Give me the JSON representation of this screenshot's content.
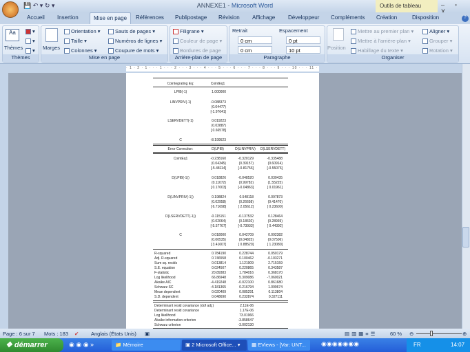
{
  "window": {
    "title_doc": "ANNEXE1",
    "title_sep": " - ",
    "title_app": "Microsoft Word",
    "context_tab": "Outils de tableau",
    "controls": "– ▫ X"
  },
  "tabs": [
    "Accueil",
    "Insertion",
    "Mise en page",
    "Références",
    "Publipostage",
    "Révision",
    "Affichage",
    "Développeur",
    "Compléments",
    "Création",
    "Disposition"
  ],
  "ribbon": {
    "themes": {
      "label": "Thèmes",
      "button": "Thèmes"
    },
    "mise_en_page": {
      "label": "Mise en page",
      "marges": "Marges",
      "orientation": "Orientation ▾",
      "taille": "Taille ▾",
      "colonnes": "Colonnes ▾",
      "sauts": "Sauts de pages ▾",
      "numeros": "Numéros de lignes ▾",
      "coupure": "Coupure de mots ▾"
    },
    "arriere_plan": {
      "label": "Arrière-plan de page",
      "filigrane": "Filigrane ▾",
      "couleur": "Couleur de page ▾",
      "bordures": "Bordures de page"
    },
    "paragraphe": {
      "label": "Paragraphe",
      "retrait": "Retrait",
      "espacement": "Espacement",
      "retrait_gauche": "0 cm",
      "retrait_droit": "0 cm",
      "avant": "0 pt",
      "apres": "10 pt"
    },
    "organiser": {
      "label": "Organiser",
      "position": "Position",
      "premier_plan": "Mettre au premier plan ▾",
      "arriere_plan": "Mettre à l'arrière-plan ▾",
      "habillage": "Habillage du texte ▾",
      "aligner": "Aligner ▾",
      "grouper": "Grouper ▾",
      "rotation": "Rotation ▾"
    }
  },
  "ruler": "· 1 · 2 · 1 · · · 1 · · · 2 · · · 3 · · · 4 · · · 5 · · · 6 · · · 7 · · · 8 · · · 9 · · · 10 · · · 11 · · · 12 · · · 13 · · · 14 · · · 15 · · · 16 · · · 17 · · · 18",
  "table": {
    "coint_header": [
      "Cointegrating Eq:",
      "CointEq1"
    ],
    "coint_rows": [
      {
        "label": "LPIB(-1)",
        "vals": [
          "1.000000"
        ]
      },
      {
        "label": "LINVPRIV(-1)",
        "vals": [
          "-0.088373",
          "(0.04477)",
          "[-1.97641]"
        ]
      },
      {
        "label": "LSERVDETT(-1)",
        "vals": [
          "0.019223",
          "(0.02887)",
          "[ 0.66578]"
        ]
      },
      {
        "label": "C",
        "vals": [
          "-8.199523"
        ]
      }
    ],
    "ec_header": [
      "Error Correction:",
      "D(LPIB)",
      "D(LINVPRIV)",
      "D(LSERVDETT)"
    ],
    "ec_rows": [
      {
        "label": "CointEq1",
        "cols": [
          [
            "-0.238160",
            "(0.04345)",
            "[-5.48114]"
          ],
          [
            "-0.320129",
            "(0.39157)",
            "[-0.81756]"
          ],
          [
            "-0.335488",
            "(0.60914)",
            "[-0.55076]"
          ]
        ]
      },
      {
        "label": "D(LPIB(-1))",
        "cols": [
          [
            "0.018826",
            "(0.11072)",
            "[ 0.17003]"
          ],
          [
            "-0.048520",
            "(0.99782)",
            "[-0.04863]"
          ],
          [
            "0.030435",
            "(1.55225)",
            "[ 0.01961]"
          ]
        ]
      },
      {
        "label": "D(LINVPRIV(-1))",
        "cols": [
          [
            "0.198824",
            "(0.02958)",
            "[ 6.71698]"
          ],
          [
            "0.548118",
            "(0.26658)",
            "[ 2.05612]"
          ],
          [
            "0.097873",
            "(0.41470)",
            "[ 0.23600]"
          ]
        ]
      },
      {
        "label": "D(LSERVDETT(-1))",
        "cols": [
          [
            "-0.115151",
            "(0.02064)",
            "[-5.57767]"
          ],
          [
            "-0.137532",
            "(0.18602)",
            "[-0.73933]"
          ],
          [
            "0.128464",
            "(0.28939)",
            "[ 0.44392]"
          ]
        ]
      },
      {
        "label": "C",
        "cols": [
          [
            "0.018000",
            "(0.00535)",
            "[ 3.41607]"
          ],
          [
            "0.042709",
            "(0.04825)",
            "[ 0.88520]"
          ],
          [
            "0.092382",
            "(0.07506)",
            "[ 1.23080]"
          ]
        ]
      }
    ],
    "stats": [
      {
        "label": "R-squared",
        "vals": [
          "0.784190",
          "0.228744",
          "0.050179"
        ]
      },
      {
        "label": "Adj. R-squared",
        "vals": [
          "0.746558",
          "0.100462",
          "-0.103271"
        ]
      },
      {
        "label": "Sum sq. resids",
        "vals": [
          "0.013814",
          "1.121909",
          "2.715159"
        ]
      },
      {
        "label": "S.E. equation",
        "vals": [
          "0.024507",
          "0.220865",
          "0.343587"
        ]
      },
      {
        "label": "F-statistic",
        "vals": [
          "20.89383",
          "1.784016",
          "0.368170"
        ]
      },
      {
        "label": "Log likelihood",
        "vals": [
          "66.86948",
          "5.309086",
          "-7.060021"
        ]
      },
      {
        "label": "Akaike AIC",
        "vals": [
          "-4.419248",
          "-0.022100",
          "0.861680"
        ]
      },
      {
        "label": "Schwarz SC",
        "vals": [
          "-4.181365",
          "0.216794",
          "1.099674"
        ]
      },
      {
        "label": "Mean dependent",
        "vals": [
          "0.020409",
          "0.085291",
          "0.113804"
        ]
      },
      {
        "label": "S.D. dependent",
        "vals": [
          "0.048690",
          "0.232874",
          "0.327111"
        ]
      }
    ],
    "det": [
      {
        "label": "Determinant resid covariance (dof adj.)",
        "val": "2.11E-06"
      },
      {
        "label": "Determinant resid covariance",
        "val": "1.17E-06"
      },
      {
        "label": "Log likelihood",
        "val": "73.01966"
      },
      {
        "label": "Akaike information criterion",
        "val": "-3.858647"
      },
      {
        "label": "Schwarz criterion",
        "val": "-3.002130"
      }
    ]
  },
  "status": {
    "page": "Page : 6 sur 7",
    "words": "Mots : 183",
    "language": "Anglais (États Unis)",
    "zoom": "60 %"
  },
  "taskbar": {
    "start": "démarrer",
    "tasks": [
      "Mémoire",
      "2 Microsoft Office...",
      "EViews - [Var: UNT..."
    ],
    "lang": "FR",
    "clock": "14:07"
  }
}
